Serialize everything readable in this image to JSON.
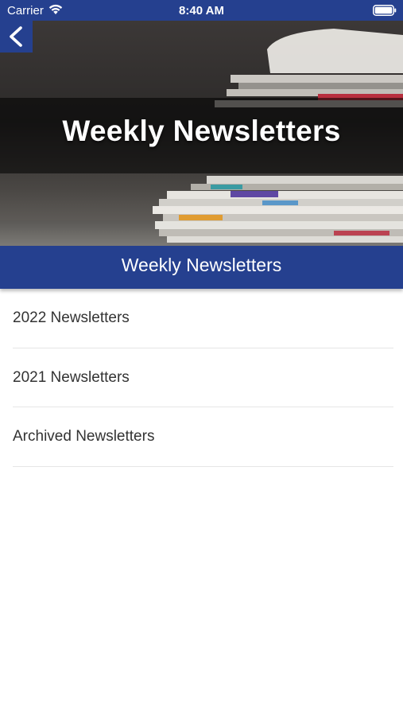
{
  "status_bar": {
    "carrier": "Carrier",
    "time": "8:40 AM",
    "icons": [
      "wifi-icon",
      "battery-icon"
    ]
  },
  "header": {
    "back_icon": "chevron-left-icon",
    "hero_title": "Weekly Newsletters"
  },
  "section": {
    "title": "Weekly Newsletters"
  },
  "list": {
    "items": [
      {
        "label": "2022 Newsletters"
      },
      {
        "label": "2021 Newsletters"
      },
      {
        "label": "Archived Newsletters"
      }
    ]
  },
  "colors": {
    "brand_blue": "#25408f",
    "text": "#333333",
    "divider": "#e6e6e6"
  }
}
